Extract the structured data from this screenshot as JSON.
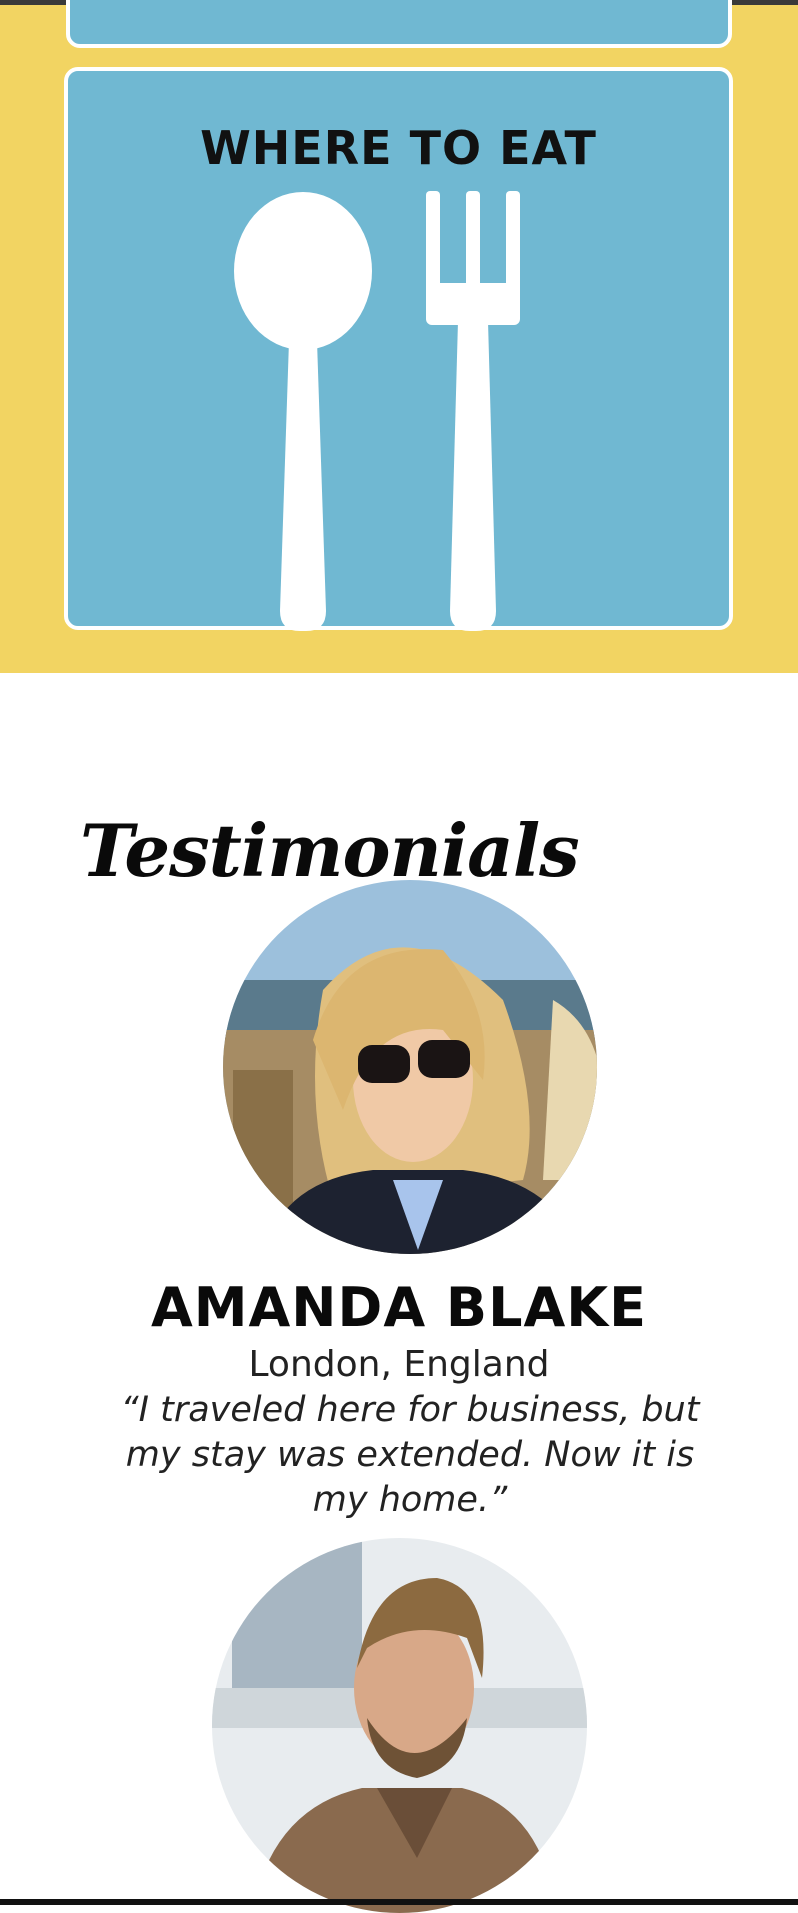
{
  "colors": {
    "card_blue": "#70b8d2",
    "banner_yellow": "#f2d462",
    "text_dark": "#111111"
  },
  "feature_card": {
    "title": "WHERE TO EAT",
    "icons": [
      "spoon-icon",
      "fork-icon"
    ]
  },
  "testimonials": {
    "heading": "Testimonials",
    "items": [
      {
        "name": "AMANDA BLAKE",
        "location": "London, England",
        "quote": "“I traveled here for business, but my stay was extended. Now it is my home.”",
        "photo": "woman-with-sunglasses-photo"
      },
      {
        "photo": "bearded-man-photo"
      }
    ]
  }
}
